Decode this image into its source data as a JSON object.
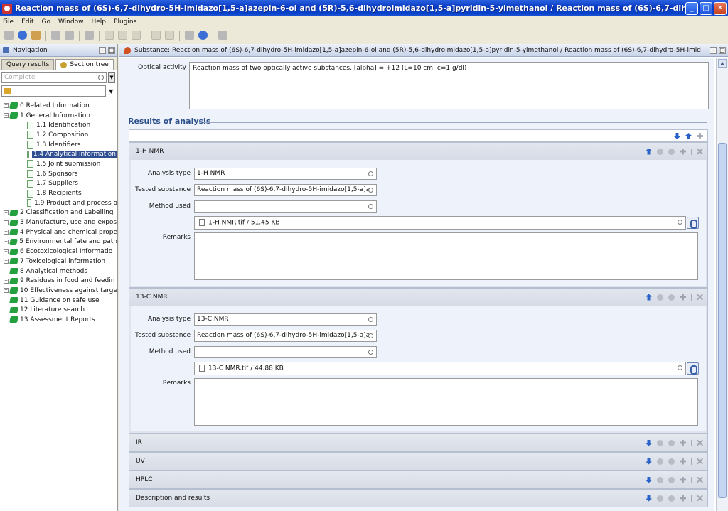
{
  "window": {
    "title": "Reaction mass of (6S)-6,7-dihydro-5H-imidazo[1,5-a]azepin-6-ol and (5R)-5,6-dihydroimidazo[1,5-a]pyridin-5-ylmethanol / Reaction mass of (6S)-6,7-dihydro-5H-imidazo[1,5-a]azepin-6-...",
    "minimize": "_",
    "maximize": "□",
    "close": "✕"
  },
  "menu": [
    "File",
    "Edit",
    "Go",
    "Window",
    "Help",
    "Plugins"
  ],
  "navigation": {
    "title": "Navigation",
    "tabs": [
      "Query results",
      "Section tree"
    ],
    "search_placeholder": "Complete",
    "tree": [
      {
        "label": "0 Related Information",
        "level": 0,
        "expander": "+"
      },
      {
        "label": "1 General Information",
        "level": 0,
        "expander": "−"
      },
      {
        "label": "1.1 Identification",
        "level": 1
      },
      {
        "label": "1.2 Composition",
        "level": 1
      },
      {
        "label": "1.3 Identifiers",
        "level": 1
      },
      {
        "label": "1.4 Analytical information",
        "level": 1,
        "selected": true
      },
      {
        "label": "1.5 Joint submission",
        "level": 1
      },
      {
        "label": "1.6 Sponsors",
        "level": 1
      },
      {
        "label": "1.7 Suppliers",
        "level": 1
      },
      {
        "label": "1.8 Recipients",
        "level": 1
      },
      {
        "label": "1.9 Product and process o",
        "level": 1
      },
      {
        "label": "2 Classification and Labelling",
        "level": 0,
        "expander": "+"
      },
      {
        "label": "3 Manufacture, use and expos",
        "level": 0,
        "expander": "+"
      },
      {
        "label": "4 Physical and chemical prope",
        "level": 0,
        "expander": "+"
      },
      {
        "label": "5 Environmental fate and path",
        "level": 0,
        "expander": "+"
      },
      {
        "label": "6 Ecotoxicological Informatio",
        "level": 0,
        "expander": "+"
      },
      {
        "label": "7 Toxicological information",
        "level": 0,
        "expander": "+"
      },
      {
        "label": "8 Analytical methods",
        "level": 0,
        "expander": ""
      },
      {
        "label": "9 Residues in food and feedin",
        "level": 0,
        "expander": "+"
      },
      {
        "label": "10 Effectiveness against targe",
        "level": 0,
        "expander": "+"
      },
      {
        "label": "11 Guidance on safe use",
        "level": 0,
        "expander": ""
      },
      {
        "label": "12 Literature search",
        "level": 0,
        "expander": ""
      },
      {
        "label": "13 Assessment Reports",
        "level": 0,
        "expander": ""
      }
    ]
  },
  "editor": {
    "title": "Substance: Reaction mass of (6S)-6,7-dihydro-5H-imidazo[1,5-a]azepin-6-ol and (5R)-5,6-dihydroimidazo[1,5-a]pyridin-5-ylmethanol / Reaction mass of (6S)-6,7-dihydro-5H-imid",
    "optical_activity_label": "Optical activity",
    "optical_activity_value": "Reaction mass of two optically active substances, [alpha] = +12 (L=10 cm; c=1 g/dl)",
    "results_title": "Results of analysis",
    "field_labels": {
      "analysis_type": "Analysis type",
      "tested_substance": "Tested substance",
      "method_used": "Method used",
      "remarks": "Remarks"
    },
    "panels": [
      {
        "name": "1-H NMR",
        "analysis_type": "1-H NMR",
        "tested_substance": "Reaction mass of (6S)-6,7-dihydro-5H-imidazo[1,5-a]a:",
        "method_used": "",
        "attachment": "1-H NMR.tif / 51.45 KB",
        "remarks": ""
      },
      {
        "name": "13-C NMR",
        "analysis_type": "13-C NMR",
        "tested_substance": "Reaction mass of (6S)-6,7-dihydro-5H-imidazo[1,5-a]a:",
        "method_used": "",
        "attachment": "13-C NMR.tif / 44.88 KB",
        "remarks": ""
      }
    ],
    "collapsed_panels": [
      "IR",
      "UV",
      "HPLC",
      "Description and results"
    ]
  }
}
